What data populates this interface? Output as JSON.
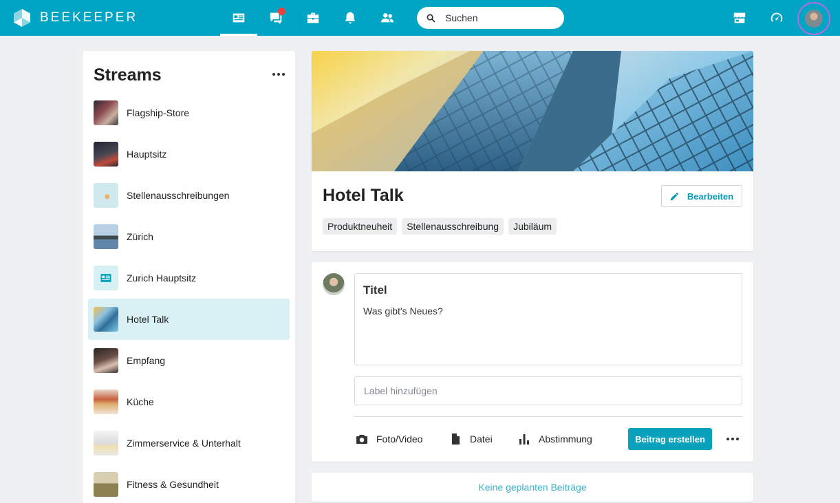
{
  "app": {
    "brand": "BEEKEEPER",
    "colors": {
      "topbar": "#00a4c4",
      "accent": "#0aa1bd",
      "active_row": "#d9f1f5",
      "notification": "#e8413c",
      "avatar_ring": "#b36bdf"
    }
  },
  "topnav": {
    "icons": [
      "streams-icon",
      "chat-icon",
      "toolbox-icon",
      "bell-icon",
      "people-icon"
    ],
    "search_placeholder": "Suchen",
    "right_icons": [
      "store-icon",
      "dashboard-icon",
      "avatar"
    ]
  },
  "sidebar": {
    "title": "Streams",
    "items": [
      {
        "label": "Flagship-Store",
        "thumb": "#5a4a52"
      },
      {
        "label": "Hauptsitz",
        "thumb": "#3c3a48"
      },
      {
        "label": "Stellenausschreibungen",
        "thumb": "#cfe9ec"
      },
      {
        "label": "Zürich",
        "thumb": "#7fa9c8"
      },
      {
        "label": "Zurich Hauptsitz",
        "thumb": "#d6f0f4"
      },
      {
        "label": "Hotel Talk",
        "thumb": "#6fb3d8"
      },
      {
        "label": "Empfang",
        "thumb": "#4a3a38"
      },
      {
        "label": "Küche",
        "thumb": "#d9b9a0"
      },
      {
        "label": "Zimmerservice & Unterhalt",
        "thumb": "#e6e8ea"
      },
      {
        "label": "Fitness & Gesundheit",
        "thumb": "#b8b08a"
      }
    ],
    "active_index": 5
  },
  "stream": {
    "title": "Hotel Talk",
    "edit_label": "Bearbeiten",
    "tags": [
      "Produktneuheit",
      "Stellenausschreibung",
      "Jubiläum"
    ]
  },
  "composer": {
    "title_placeholder": "Titel",
    "body_placeholder": "Was gibt's Neues?",
    "label_placeholder": "Label hinzufügen",
    "actions": [
      "Foto/Video",
      "Datei",
      "Abstimmung"
    ],
    "submit_label": "Beitrag erstellen"
  },
  "scheduled": {
    "text": "Keine geplanten Beiträge"
  }
}
